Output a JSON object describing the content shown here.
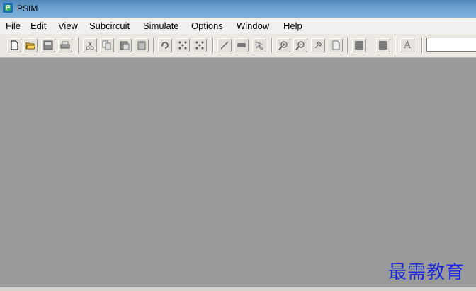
{
  "window": {
    "title": "PSIM"
  },
  "menu": [
    "File",
    "Edit",
    "View",
    "Subcircuit",
    "Simulate",
    "Options",
    "Window",
    "Help"
  ],
  "toolbar": {
    "buttons": [
      "new",
      "open",
      "save",
      "print",
      "cut",
      "copy",
      "paste",
      "paste-special",
      "rotate",
      "flip-horizontal",
      "flip-vertical",
      "wire",
      "label",
      "select",
      "zoom-in",
      "zoom-out",
      "zoom-to-fit",
      "page",
      "element-library-1",
      "element-library-2",
      "text"
    ],
    "text_button_glyph": "A",
    "combo_value": ""
  },
  "watermark": "最需教育"
}
